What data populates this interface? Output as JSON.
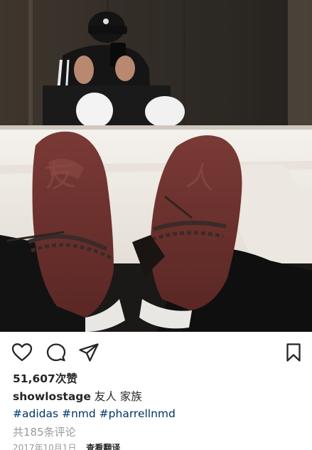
{
  "post": {
    "photo_alt": "",
    "likes": "51,607次赞",
    "caption": {
      "username": "showlostage",
      "text": "友人 家族"
    },
    "hashtags": [
      "#adidas",
      "#nmd",
      "#pharrellnmd"
    ],
    "comments_link": "共185条评论",
    "date": "2017年10月1日",
    "translate": "查看翻译"
  },
  "icons": {
    "like": "heart-icon",
    "comment": "speech-bubble-icon",
    "share": "paper-plane-icon",
    "save": "bookmark-icon"
  },
  "colors": {
    "text": "#262626",
    "hashtag": "#003569",
    "muted": "#999999",
    "background": "#ffffff"
  }
}
